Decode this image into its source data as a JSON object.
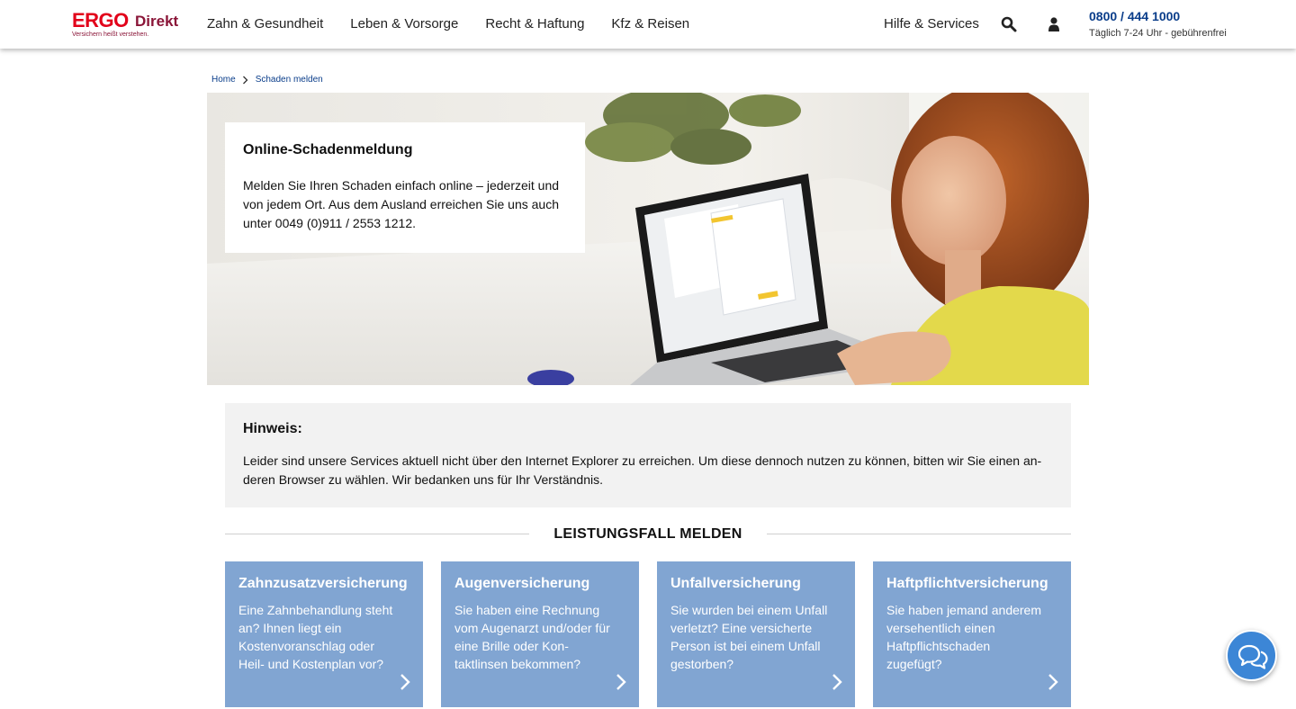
{
  "header": {
    "logo": {
      "brand": "ERGO",
      "sub": "Direkt",
      "tagline": "Versichern heißt verstehen."
    },
    "nav": [
      "Zahn & Gesundheit",
      "Leben & Vorsorge",
      "Recht & Haftung",
      "Kfz & Reisen"
    ],
    "help": "Hilfe & Services",
    "search_icon": "search-icon",
    "user_icon": "user-icon",
    "phone": "0800 / 444 1000",
    "phone_hours": "Täglich 7-24 Uhr - gebührenfrei"
  },
  "breadcrumb": {
    "items": [
      "Home",
      "Schaden melden"
    ],
    "separator_icon": "chevron-right-icon"
  },
  "hero": {
    "title": "Online-Schadenmeldung",
    "text": "Melden Sie Ihren Schaden einfach online – jederzeit und von jedem Ort. Aus dem Ausland erreichen Sie uns auch unter 0049 (0)911 / 2553 1212."
  },
  "notice": {
    "title": "Hinweis:",
    "text": "Leider sind unsere Services aktuell nicht über den Internet Explorer zu erreichen. Um diese dennoch nutzen zu können, bitten wir Sie einen an­deren Browser zu wählen. Wir bedanken uns für Ihr Verständnis."
  },
  "section": {
    "title": "LEISTUNGSFALL MELDEN"
  },
  "tiles": [
    {
      "title": "Zahnzusatzversicherung",
      "text": "Eine Zahnbehandlung steht an? Ihnen liegt ein Kostenvoranschlag oder Heil- und Kostenplan vor?"
    },
    {
      "title": "Augenversicherung",
      "text": "Sie haben eine Rechnung vom Augenarzt und/oder für eine Brille oder Kon­taktlinsen bekommen?"
    },
    {
      "title": "Unfallversicherung",
      "text": "Sie wurden bei einem Un­fall verletzt? Eine versi­cherte Person ist bei ei­nem Unfall gestorben?"
    },
    {
      "title": "Haftpflichtversicherung",
      "text": "Sie haben jemand ande­rem versehentlich einen Haftpflichtschaden zugefügt?"
    }
  ],
  "chat_icon": "chat-bubbles-icon",
  "colors": {
    "brand_red": "#e2001a",
    "brand_wine": "#8a1538",
    "link_blue": "#0a3d8a",
    "tile_blue": "#81a5d2",
    "chat_blue": "#3c86d6"
  }
}
